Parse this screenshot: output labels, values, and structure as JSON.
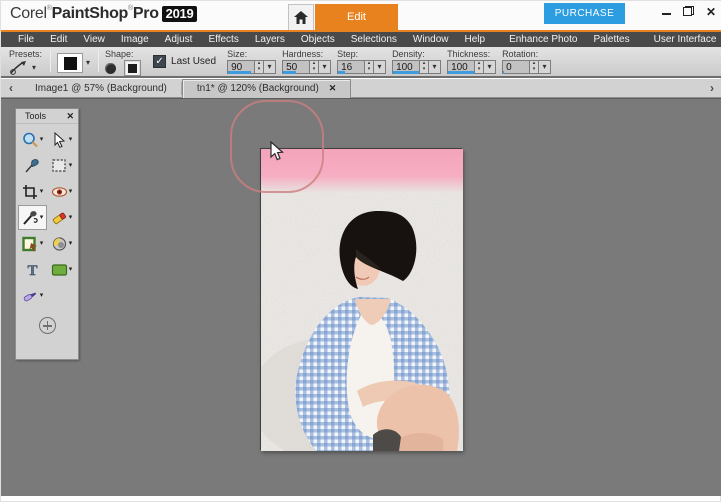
{
  "colors": {
    "accent_orange": "#e8821f",
    "purchase_blue": "#2d9de2",
    "spinner_accent_blue": "#3f9bdc",
    "menubar_bg": "#4a4a4a",
    "workspace_bg": "#7a7a7a",
    "photo_pink_band": "#f5a8bd"
  },
  "titlebar": {
    "brand_corel": "Corel",
    "brand_product": "PaintShop",
    "brand_pro": "Pro",
    "brand_year": "2019",
    "reg_mark": "®",
    "edit_tab_label": "Edit",
    "purchase_label": "PURCHASE",
    "window_controls": {
      "close": "✕"
    }
  },
  "menubar": {
    "items": [
      "File",
      "Edit",
      "View",
      "Image",
      "Adjust",
      "Effects",
      "Layers",
      "Objects",
      "Selections",
      "Window",
      "Help",
      "Enhance Photo",
      "Palettes",
      "User Interface"
    ]
  },
  "toolbar": {
    "presets_label": "Presets:",
    "shape_label": "Shape:",
    "last_used_label": "Last Used",
    "check_glyph": "✓",
    "dropdown_glyph": "▾",
    "spin_up_glyph": "▴",
    "spin_down_glyph": "▾",
    "spinners": [
      {
        "label": "Size:",
        "value": "90",
        "fill_pct": 88
      },
      {
        "label": "Hardness:",
        "value": "50",
        "fill_pct": 50
      },
      {
        "label": "Step:",
        "value": "16",
        "fill_pct": 28
      },
      {
        "label": "Density:",
        "value": "100",
        "fill_pct": 100
      },
      {
        "label": "Thickness:",
        "value": "100",
        "fill_pct": 100
      },
      {
        "label": "Rotation:",
        "value": "0",
        "fill_pct": 4
      }
    ]
  },
  "document_tabs": {
    "scroll_left_glyph": "‹",
    "scroll_right_glyph": "›",
    "tabs": [
      {
        "label": "Image1 @  57% (Background)",
        "active": false
      },
      {
        "label": "tn1* @ 120% (Background)",
        "active": true,
        "close_glyph": "✕"
      }
    ]
  },
  "tools_panel": {
    "title": "Tools",
    "close_glyph": "✕",
    "tools": [
      {
        "name": "zoom"
      },
      {
        "name": "pick"
      },
      {
        "name": "dropper"
      },
      {
        "name": "selection"
      },
      {
        "name": "crop"
      },
      {
        "name": "red-eye"
      },
      {
        "name": "clone-brush"
      },
      {
        "name": "eraser"
      },
      {
        "name": "picture-frame"
      },
      {
        "name": "dodge-burn"
      },
      {
        "name": "text"
      },
      {
        "name": "preset-shape"
      },
      {
        "name": "oil-brush"
      },
      {
        "name": "add-more-tools"
      }
    ]
  }
}
